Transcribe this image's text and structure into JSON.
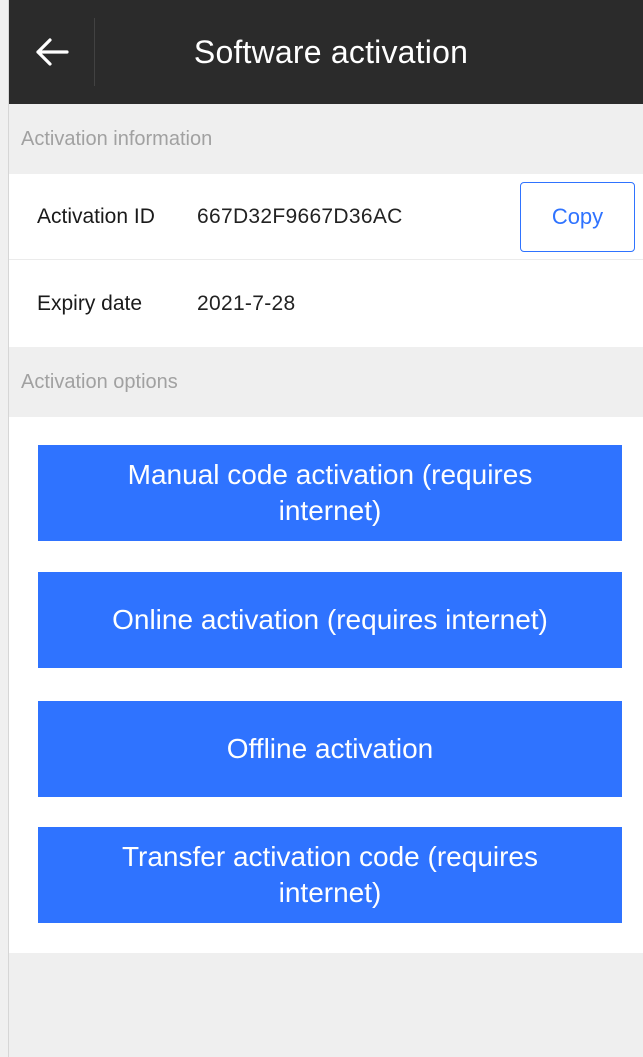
{
  "header": {
    "title": "Software activation",
    "back_icon": "back-arrow-icon"
  },
  "sections": {
    "activation_information": "Activation information",
    "activation_options": "Activation options"
  },
  "activation_info": {
    "activation_id_label": "Activation ID",
    "activation_id_value": "667D32F9667D36AC",
    "copy_label": "Copy",
    "expiry_date_label": "Expiry date",
    "expiry_date_value": "2021-7-28"
  },
  "options": [
    {
      "label": "Manual code activation (requires internet)"
    },
    {
      "label": "Online activation (requires internet)"
    },
    {
      "label": "Offline activation"
    },
    {
      "label": "Transfer activation code (requires internet)"
    }
  ],
  "colors": {
    "header_bg": "#2b2b2b",
    "accent": "#2f73ff",
    "page_bg": "#efefef",
    "section_text": "#a1a1a1"
  }
}
